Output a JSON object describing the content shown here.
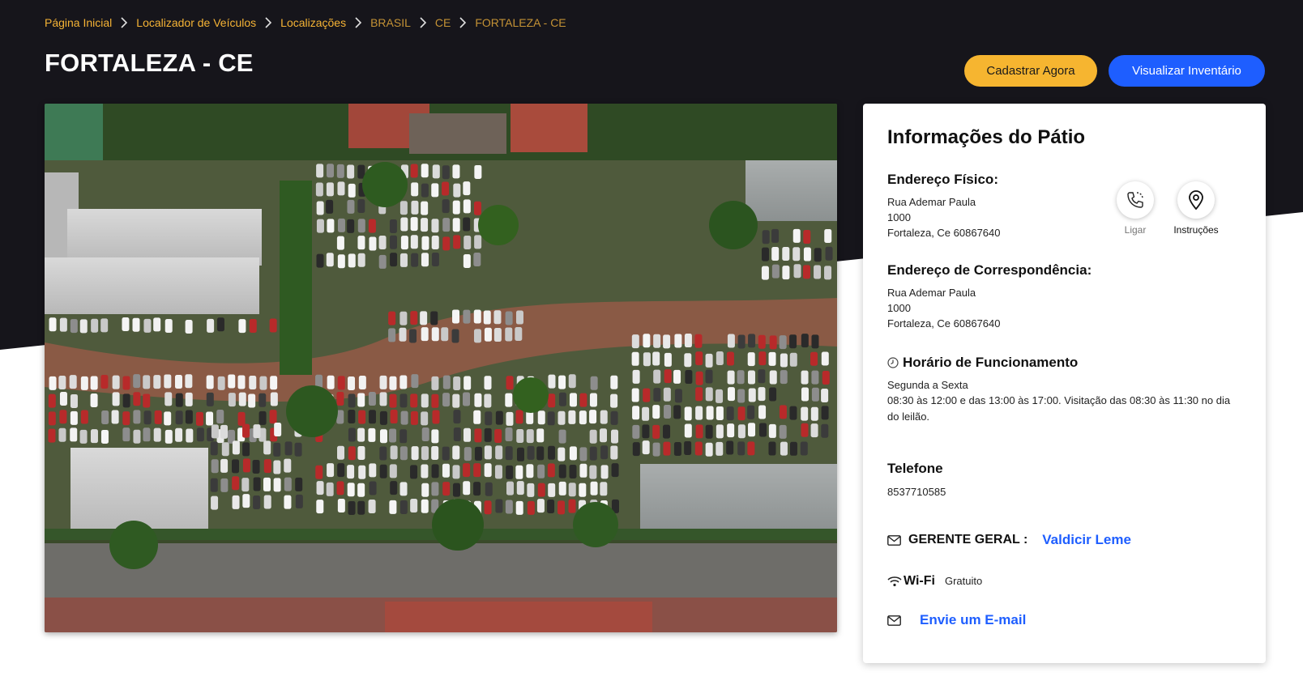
{
  "breadcrumb": [
    {
      "label": "Página Inicial",
      "link": true
    },
    {
      "label": "Localizador de Veículos",
      "link": true
    },
    {
      "label": "Localizações",
      "link": true
    },
    {
      "label": "BRASIL",
      "link": false
    },
    {
      "label": "CE",
      "link": false
    },
    {
      "label": "FORTALEZA - CE",
      "link": false
    }
  ],
  "page": {
    "title": "FORTALEZA - CE"
  },
  "actions": {
    "register_label": "Cadastrar Agora",
    "inventory_label": "Visualizar Inventário"
  },
  "colors": {
    "dark_bg": "#16151b",
    "accent_yellow": "#f6b530",
    "accent_blue": "#1e5eff",
    "breadcrumb": "#f5b335"
  },
  "card": {
    "title": "Informações do Pátio",
    "physical_address": {
      "heading": "Endereço Físico:",
      "line1": "Rua Ademar Paula",
      "line2": "1000",
      "line3": "Fortaleza, Ce 60867640"
    },
    "call": {
      "icon": "phone-icon",
      "label": "Ligar"
    },
    "directions": {
      "icon": "map-pin-icon",
      "label": "Instruções"
    },
    "mailing_address": {
      "heading": "Endereço de Correspondência:",
      "line1": "Rua Ademar Paula",
      "line2": "1000",
      "line3": "Fortaleza, Ce 60867640"
    },
    "hours": {
      "heading": "Horário de Funcionamento",
      "days": "Segunda a Sexta",
      "times": "08:30 às 12:00 e das 13:00 às 17:00. Visitação das 08:30 às 11:30 no dia do leilão."
    },
    "phone": {
      "heading": "Telefone",
      "number": "8537710585"
    },
    "manager": {
      "label": "GERENTE GERAL :",
      "name": "Valdicir Leme"
    },
    "wifi": {
      "label": "Wi-Fi",
      "value": "Gratuito"
    },
    "email": {
      "label": "Envie um E-mail"
    }
  }
}
